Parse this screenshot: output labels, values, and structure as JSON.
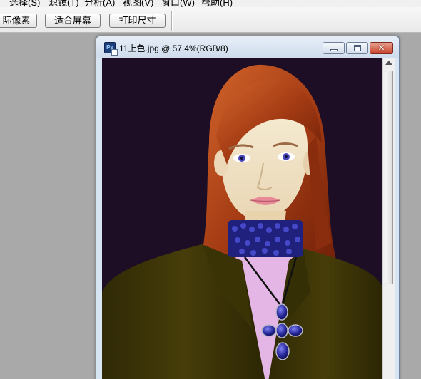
{
  "menubar": {
    "items": [
      "选择(S)",
      "滤镜(T)",
      "分析(A)",
      "视图(V)",
      "窗口(W)",
      "帮助(H)"
    ]
  },
  "options_bar": {
    "buttons": [
      "际像素",
      "适合屏幕",
      "打印尺寸"
    ]
  },
  "document": {
    "title": "11上色.jpg @ 57.4%(RGB/8)",
    "icon": "photoshop-file-icon",
    "zoom": "57.4%",
    "mode": "RGB/8",
    "window_controls": [
      "minimize-icon",
      "maximize-icon",
      "close-icon"
    ]
  },
  "colors": {
    "canvas_background": "#1d0e25",
    "hair": "#b4451a",
    "jacket": "#3f3707",
    "blouse": "#e4b6e6",
    "necklace": "#2a2b8c",
    "app_background": "#a9a9a9"
  }
}
